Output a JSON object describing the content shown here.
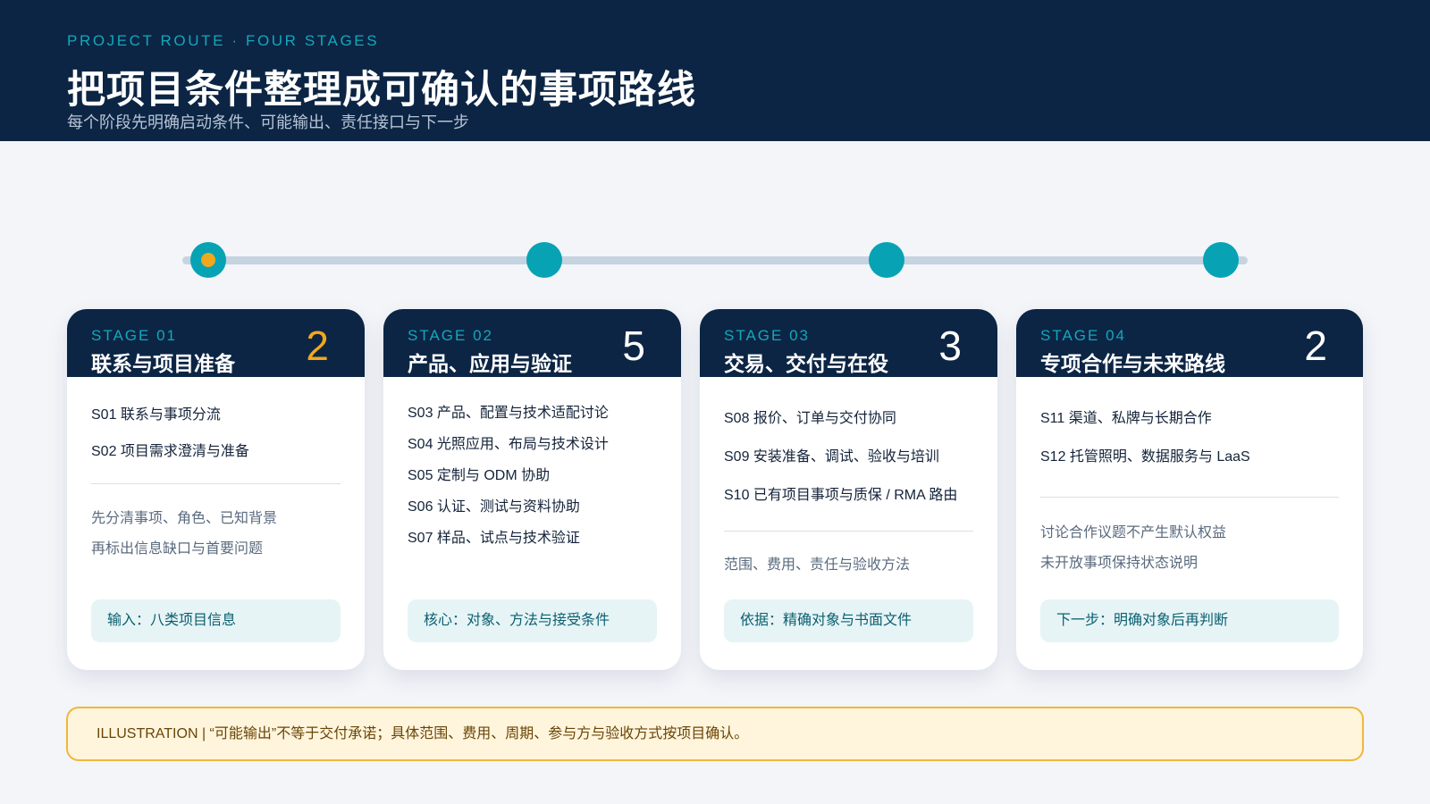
{
  "header": {
    "kicker": "PROJECT ROUTE · FOUR STAGES",
    "title": "把项目条件整理成可确认的事项路线",
    "subtitle": "每个阶段先明确启动条件、可能输出、责任接口与下一步"
  },
  "colors": {
    "navy": "#0c2544",
    "teal": "#07a3b4",
    "amber": "#f0a81c",
    "background": "#f3f5f9"
  },
  "stages": [
    {
      "label": "STAGE 01",
      "title": "联系与项目准备",
      "count": "2",
      "items": [
        "S01 联系与事项分流",
        "S02 项目需求澄清与准备"
      ],
      "notes": [
        "先分清事项、角色、已知背景",
        "再标出信息缺口与首要问题"
      ],
      "footer": "输入：八类项目信息"
    },
    {
      "label": "STAGE 02",
      "title": "产品、应用与验证",
      "count": "5",
      "items": [
        "S03 产品、配置与技术适配讨论",
        "S04 光照应用、布局与技术设计",
        "S05 定制与 ODM 协助",
        "S06 认证、测试与资料协助",
        "S07 样品、试点与技术验证"
      ],
      "notes": [],
      "footer": "核心：对象、方法与接受条件"
    },
    {
      "label": "STAGE 03",
      "title": "交易、交付与在役",
      "count": "3",
      "items": [
        "S08 报价、订单与交付协同",
        "S09 安装准备、调试、验收与培训",
        "S10 已有项目事项与质保 / RMA 路由"
      ],
      "notes": [
        "范围、费用、责任与验收方法"
      ],
      "footer": "依据：精确对象与书面文件"
    },
    {
      "label": "STAGE 04",
      "title": "专项合作与未来路线",
      "count": "2",
      "items": [
        "S11 渠道、私牌与长期合作",
        "S12 托管照明、数据服务与 LaaS"
      ],
      "notes": [
        "讨论合作议题不产生默认权益",
        "未开放事项保持状态说明"
      ],
      "footer": "下一步：明确对象后再判断"
    }
  ],
  "banner": {
    "text": "ILLUSTRATION | “可能输出”不等于交付承诺；具体范围、费用、周期、参与方与验收方式按项目确认。"
  }
}
